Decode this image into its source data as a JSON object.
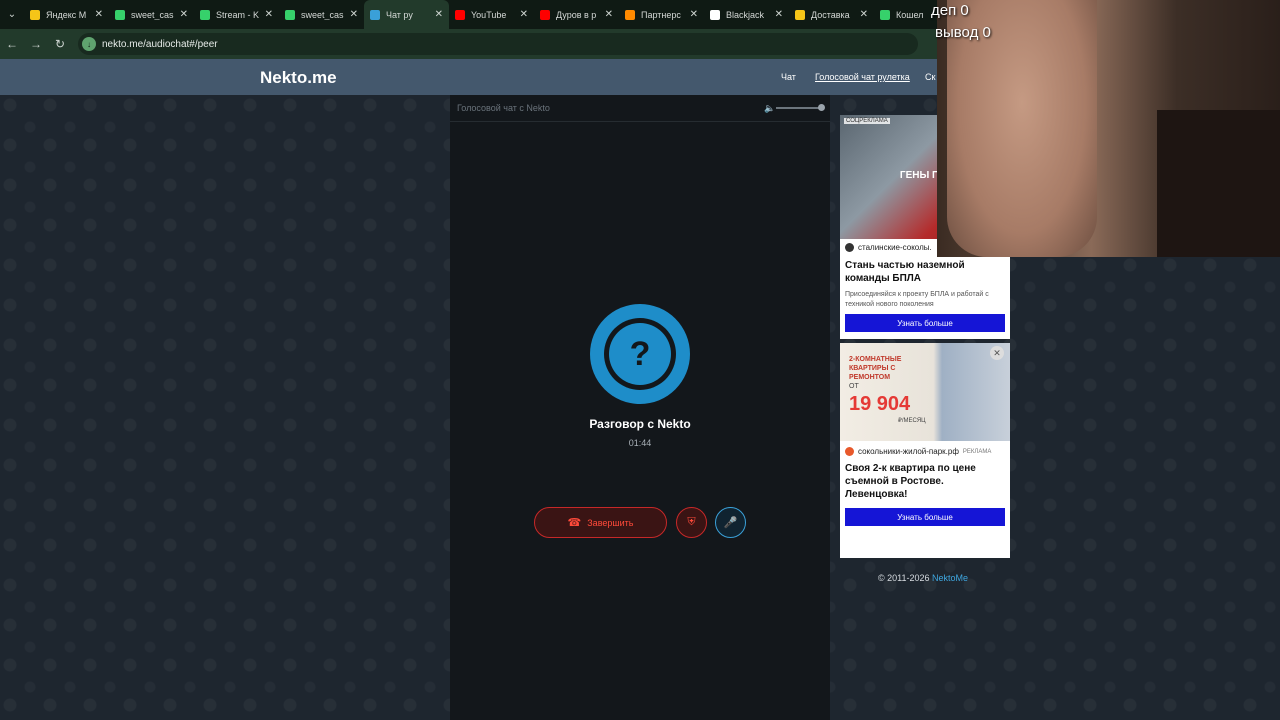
{
  "browser": {
    "tabs": [
      {
        "label": "Яндекс М",
        "fav_color": "#f5c518"
      },
      {
        "label": "sweet_cas",
        "fav_color": "#36d16b"
      },
      {
        "label": "Stream - K",
        "fav_color": "#36d16b"
      },
      {
        "label": "sweet_cas",
        "fav_color": "#36d16b"
      },
      {
        "label": "Чат ру",
        "fav_color": "#3aa0d8",
        "active": true
      },
      {
        "label": "YouTube",
        "fav_color": "#ff0000"
      },
      {
        "label": "Дуров в р",
        "fav_color": "#ff0000"
      },
      {
        "label": "Партнерс",
        "fav_color": "#ff8a00"
      },
      {
        "label": "Blackjack",
        "fav_color": "#ffffff"
      },
      {
        "label": "Доставка",
        "fav_color": "#f5c518"
      },
      {
        "label": "Кошел",
        "fav_color": "#36d16b"
      }
    ],
    "url": "nekto.me/audiochat#/peer"
  },
  "site": {
    "logo": "Nekto.me",
    "nav": [
      "Чат",
      "Голосовой чат рулетка",
      "Ск"
    ]
  },
  "chat": {
    "panel_title": "Голосовой чат с Nekto",
    "avatar_glyph": "?",
    "peer_title": "Разговор с Nekto",
    "timer": "01:44",
    "end_label": "Завершить"
  },
  "ads": {
    "ad1": {
      "tag": "СОЦРЕКЛАМА",
      "headline": "ГЕНЫ ПОБЕД В НАШЕЙ",
      "domain": "сталинские-соколы.",
      "title": "Стань частью наземной команды БПЛА",
      "desc": "Присоединяйся к проекту БПЛА и работай с техникой нового поколения",
      "cta": "Узнать больше"
    },
    "ad2": {
      "img_top": "2-КОМНАТНЫЕ КВАРТИРЫ С РЕМОНТОМ",
      "img_from": "ОТ",
      "img_price": "19 904",
      "img_unit": "₽/МЕСЯЦ",
      "domain": "сокольники-жилой-парк.рф",
      "marker": "РЕКЛАМА",
      "title": "Своя 2-к квартира по цене съемной в Ростове. Левенцовка!",
      "cta": "Узнать больше"
    }
  },
  "footer": {
    "copyright": "© 2011-2026",
    "link": "NektoMe"
  },
  "overlay": {
    "deposit": "деп 0",
    "withdraw": "вывод 0"
  }
}
